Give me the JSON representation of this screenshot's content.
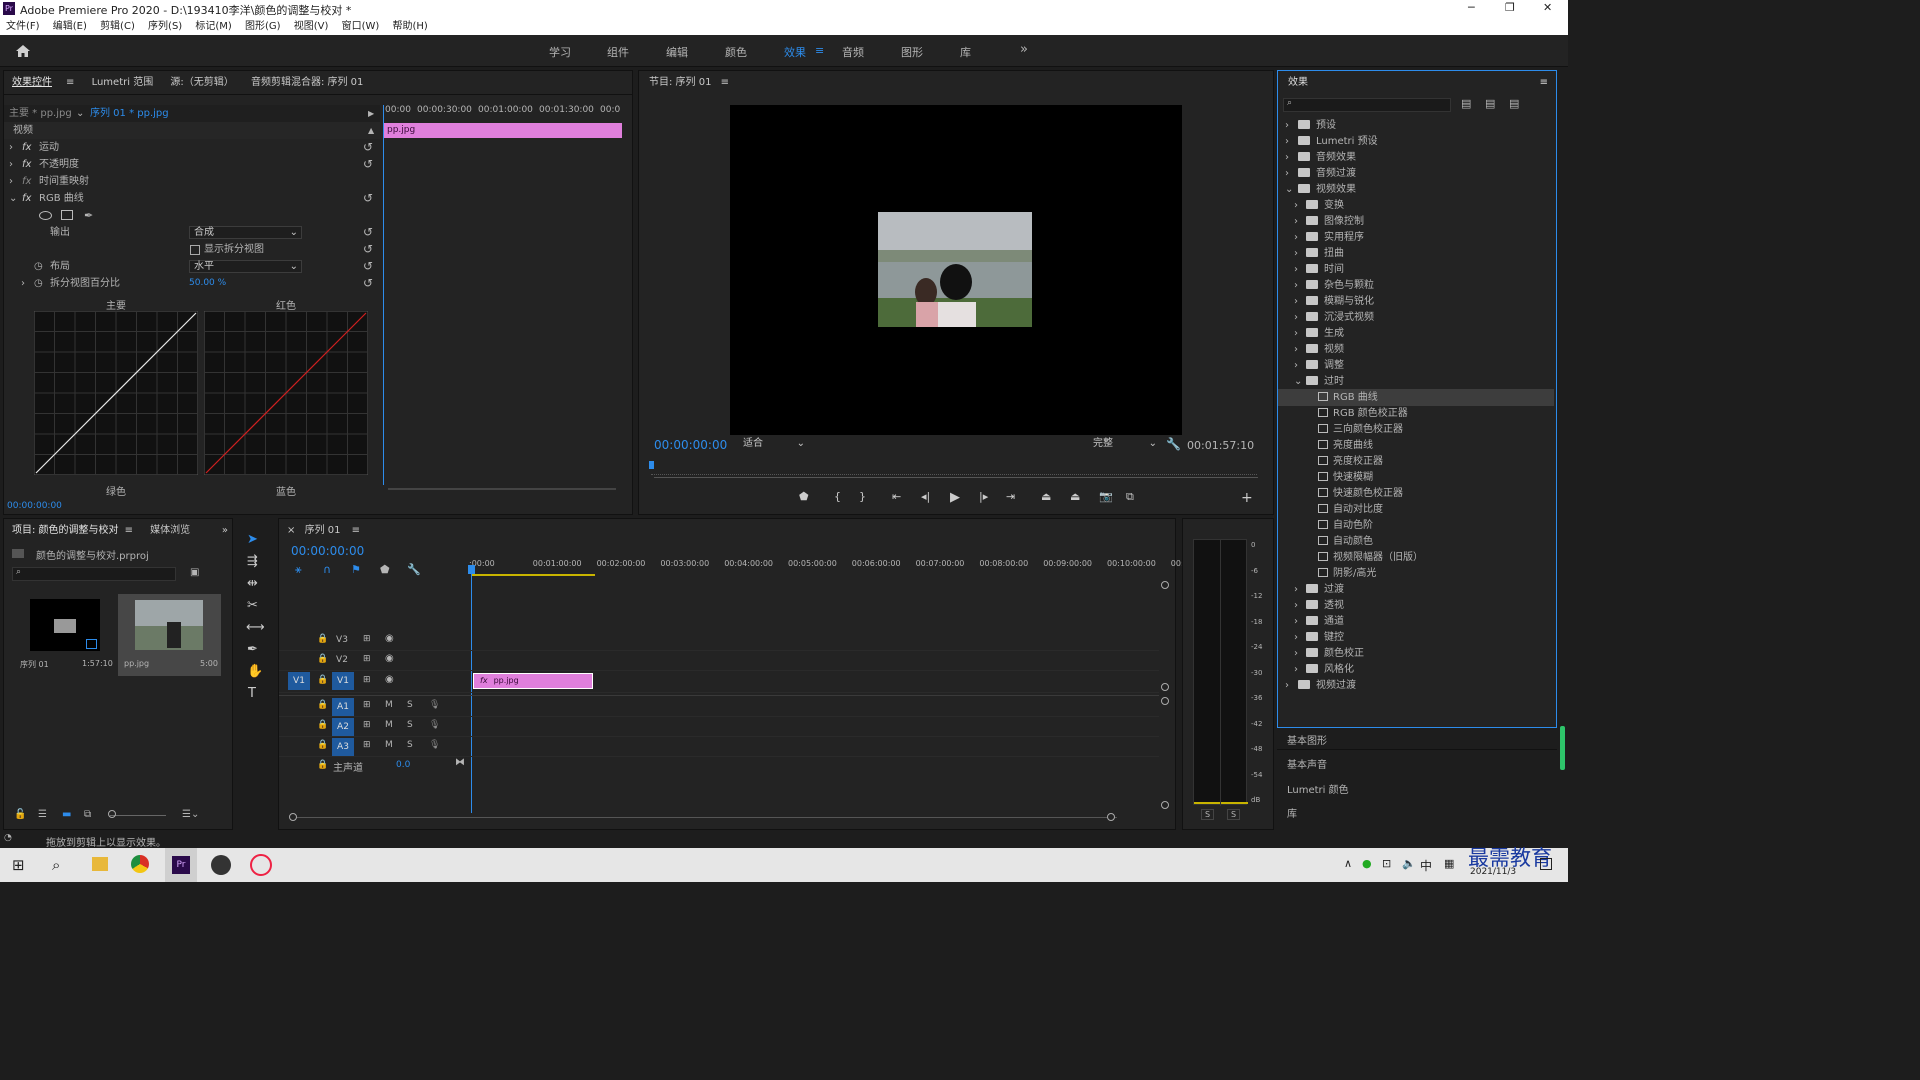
{
  "app": {
    "icon": "Pr",
    "title": "Adobe Premiere Pro 2020 - D:\\193410李洋\\颜色的调整与校对 *"
  },
  "window_controls": {
    "minimize": "─",
    "maximize": "❐",
    "close": "✕"
  },
  "menu": [
    "文件(F)",
    "编辑(E)",
    "剪辑(C)",
    "序列(S)",
    "标记(M)",
    "图形(G)",
    "视图(V)",
    "窗口(W)",
    "帮助(H)"
  ],
  "workspaces": [
    "学习",
    "组件",
    "编辑",
    "颜色",
    "效果",
    "音频",
    "图形",
    "库"
  ],
  "workspace_active": "效果",
  "workspace_more": "»",
  "effect_controls": {
    "tabs": [
      "效果控件",
      "Lumetri 范围",
      "源:（无剪辑）",
      "音频剪辑混合器: 序列 01"
    ],
    "master": "主要 * pp.jpg",
    "clip": "序列 01 * pp.jpg",
    "ruler": [
      "00:00",
      "00:00:30:00",
      "00:01:00:00",
      "00:01:30:00",
      "00:0"
    ],
    "clip_bar": "pp.jpg",
    "section": "视频",
    "effects": [
      {
        "fx": "fx",
        "name": "运动"
      },
      {
        "fx": "fx",
        "name": "不透明度"
      },
      {
        "fx": "fx",
        "name": "时间重映射"
      },
      {
        "fx": "fx",
        "name": "RGB 曲线"
      }
    ],
    "output_label": "输出",
    "output_value": "合成",
    "split_label": "显示拆分视图",
    "layout_label": "布局",
    "layout_value": "水平",
    "split_pct_label": "拆分视图百分比",
    "split_pct_value": "50.00 %",
    "curve_labels": {
      "master": "主要",
      "red": "红色",
      "green": "绿色",
      "blue": "蓝色"
    },
    "timecode": "00:00:00:00"
  },
  "program": {
    "title": "节目: 序列 01",
    "timecode": "00:00:00:00",
    "fit": "适合",
    "quality": "完整",
    "duration": "00:01:57:10"
  },
  "effects_panel": {
    "title": "效果",
    "top": [
      {
        "name": "预设"
      },
      {
        "name": "Lumetri 预设"
      },
      {
        "name": "音频效果"
      },
      {
        "name": "音频过渡"
      },
      {
        "name": "视频效果"
      }
    ],
    "video_sub": [
      "变换",
      "图像控制",
      "实用程序",
      "扭曲",
      "时间",
      "杂色与颗粒",
      "模糊与锐化",
      "沉浸式视频",
      "生成",
      "视频",
      "调整",
      "过时"
    ],
    "obsolete": [
      "RGB 曲线",
      "RGB 颜色校正器",
      "三向颜色校正器",
      "亮度曲线",
      "亮度校正器",
      "快速模糊",
      "快速颜色校正器",
      "自动对比度",
      "自动色阶",
      "自动颜色",
      "视频限幅器（旧版）",
      "阴影/高光"
    ],
    "more_sub": [
      "过渡",
      "透视",
      "通道",
      "键控",
      "颜色校正",
      "风格化"
    ],
    "last": "视频过渡",
    "collapsed": [
      "基本图形",
      "基本声音",
      "Lumetri 颜色",
      "库"
    ]
  },
  "project": {
    "tabs": [
      "项目: 颜色的调整与校对",
      "媒体浏览"
    ],
    "file": "颜色的调整与校对.prproj",
    "items": [
      {
        "name": "序列 01",
        "dur": "1:57:10"
      },
      {
        "name": "pp.jpg",
        "dur": "5:00"
      }
    ]
  },
  "timeline": {
    "title": "序列 01",
    "timecode": "00:00:00:00",
    "ruler": [
      ":00:00",
      "00:01:00:00",
      "00:02:00:00",
      "00:03:00:00",
      "00:04:00:00",
      "00:05:00:00",
      "00:06:00:00",
      "00:07:00:00",
      "00:08:00:00",
      "00:09:00:00",
      "00:10:00:00",
      "00:"
    ],
    "video_tracks": [
      "V3",
      "V2",
      "V1"
    ],
    "audio_tracks": [
      "A1",
      "A2",
      "A3"
    ],
    "src_v": "V1",
    "master": "主声道",
    "master_val": "0.0",
    "clip": "pp.jpg"
  },
  "meter": {
    "scale": [
      "0",
      "-6",
      "-12",
      "-18",
      "-24",
      "-30",
      "-36",
      "-42",
      "-48",
      "-54",
      "dB"
    ],
    "solo": [
      "S",
      "S"
    ]
  },
  "status": "拖放到剪辑上以显示效果。",
  "taskbar": {
    "ime": "中",
    "date": "2021/11/3",
    "watermark": "最需教育"
  },
  "colors": {
    "accent": "#2d8ceb",
    "clip": "#e07fdc",
    "curve_red": "#d02020"
  }
}
